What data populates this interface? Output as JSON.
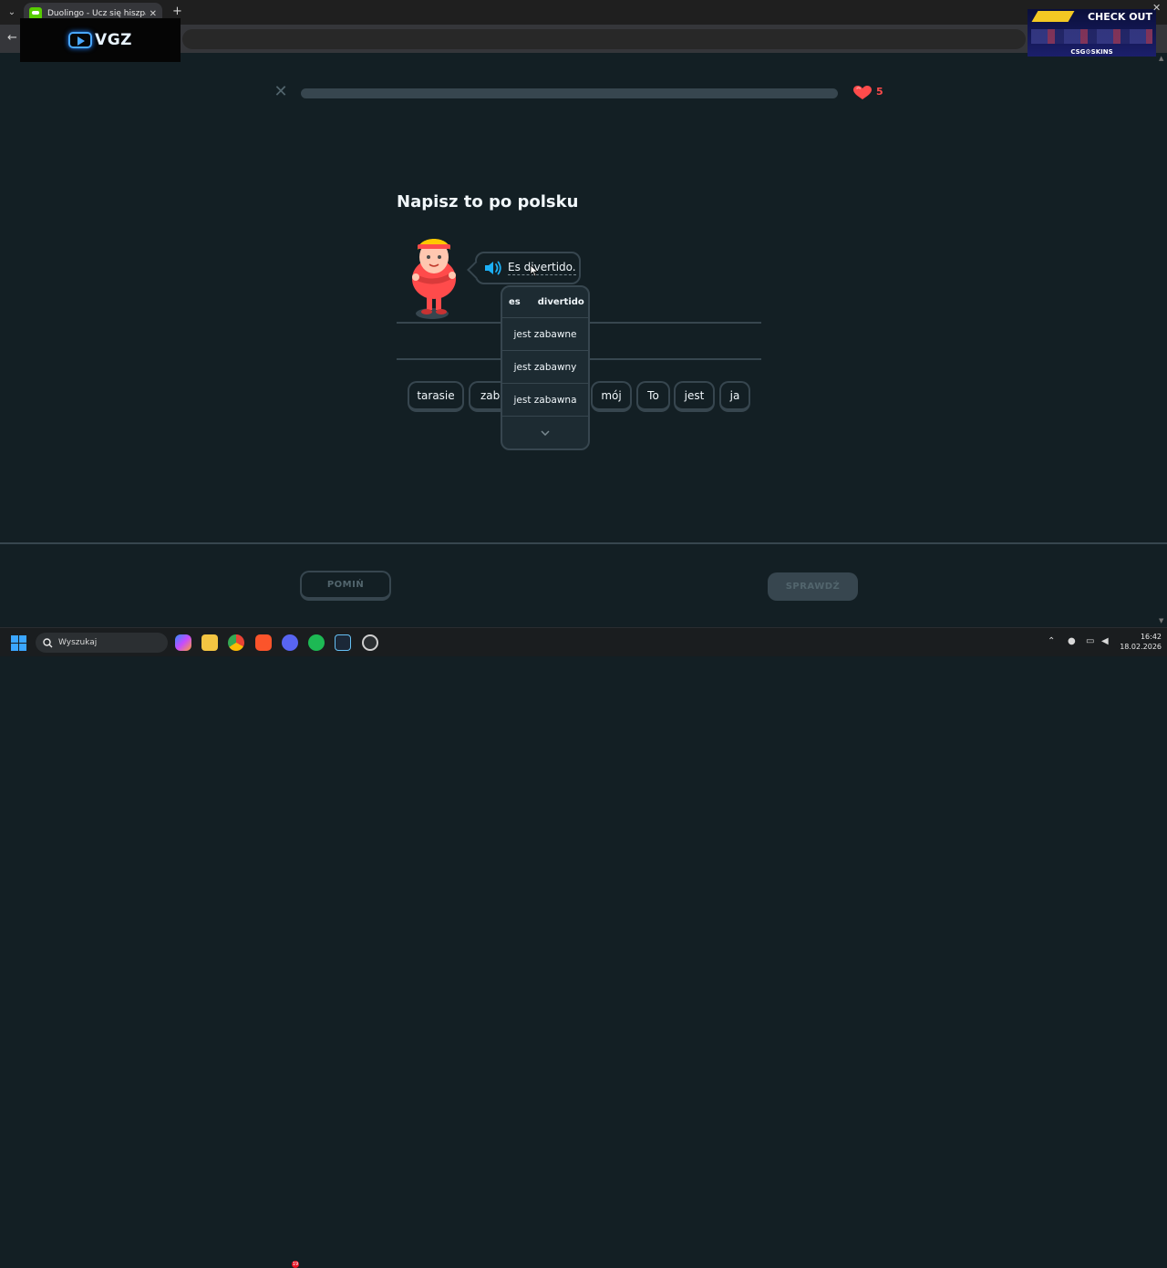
{
  "browser": {
    "tab_title": "Duolingo - Ucz się hiszpańskiego",
    "tab_close": "✕",
    "new_tab": "+",
    "back": "←",
    "tab_list": "⌄"
  },
  "overlays": {
    "vgz_logo_text": "VGZ",
    "ad_top_text": "CHECK OUT",
    "ad_brand_text": "CSG⚙SKINS"
  },
  "lesson": {
    "close": "✕",
    "hearts": "5",
    "progress_fraction": 0.0,
    "title": "Napisz to po polsku",
    "prompt": "Es divertido."
  },
  "word_bank": [
    {
      "text": "tarasie"
    },
    {
      "text": "zaba"
    },
    {
      "text": "mój"
    },
    {
      "text": "To"
    },
    {
      "text": "jest"
    },
    {
      "text": "ja"
    }
  ],
  "hint": {
    "header_word1": "es",
    "header_word2": "divertido",
    "options": [
      "jest zabawne",
      "jest zabawny",
      "jest zabawna"
    ],
    "more_icon": "chevron-down-icon"
  },
  "footer": {
    "skip_label": "POMIŃ",
    "check_label": "SPRAWDŹ"
  },
  "taskbar": {
    "search_placeholder": "Wyszukaj",
    "discord_badge": "19",
    "time": "16:42",
    "date": "18.02.2026"
  },
  "colors": {
    "background": "#131f24",
    "border": "#37464f",
    "heart": "#ff4b4b",
    "accent_blue": "#1cb0f6"
  }
}
